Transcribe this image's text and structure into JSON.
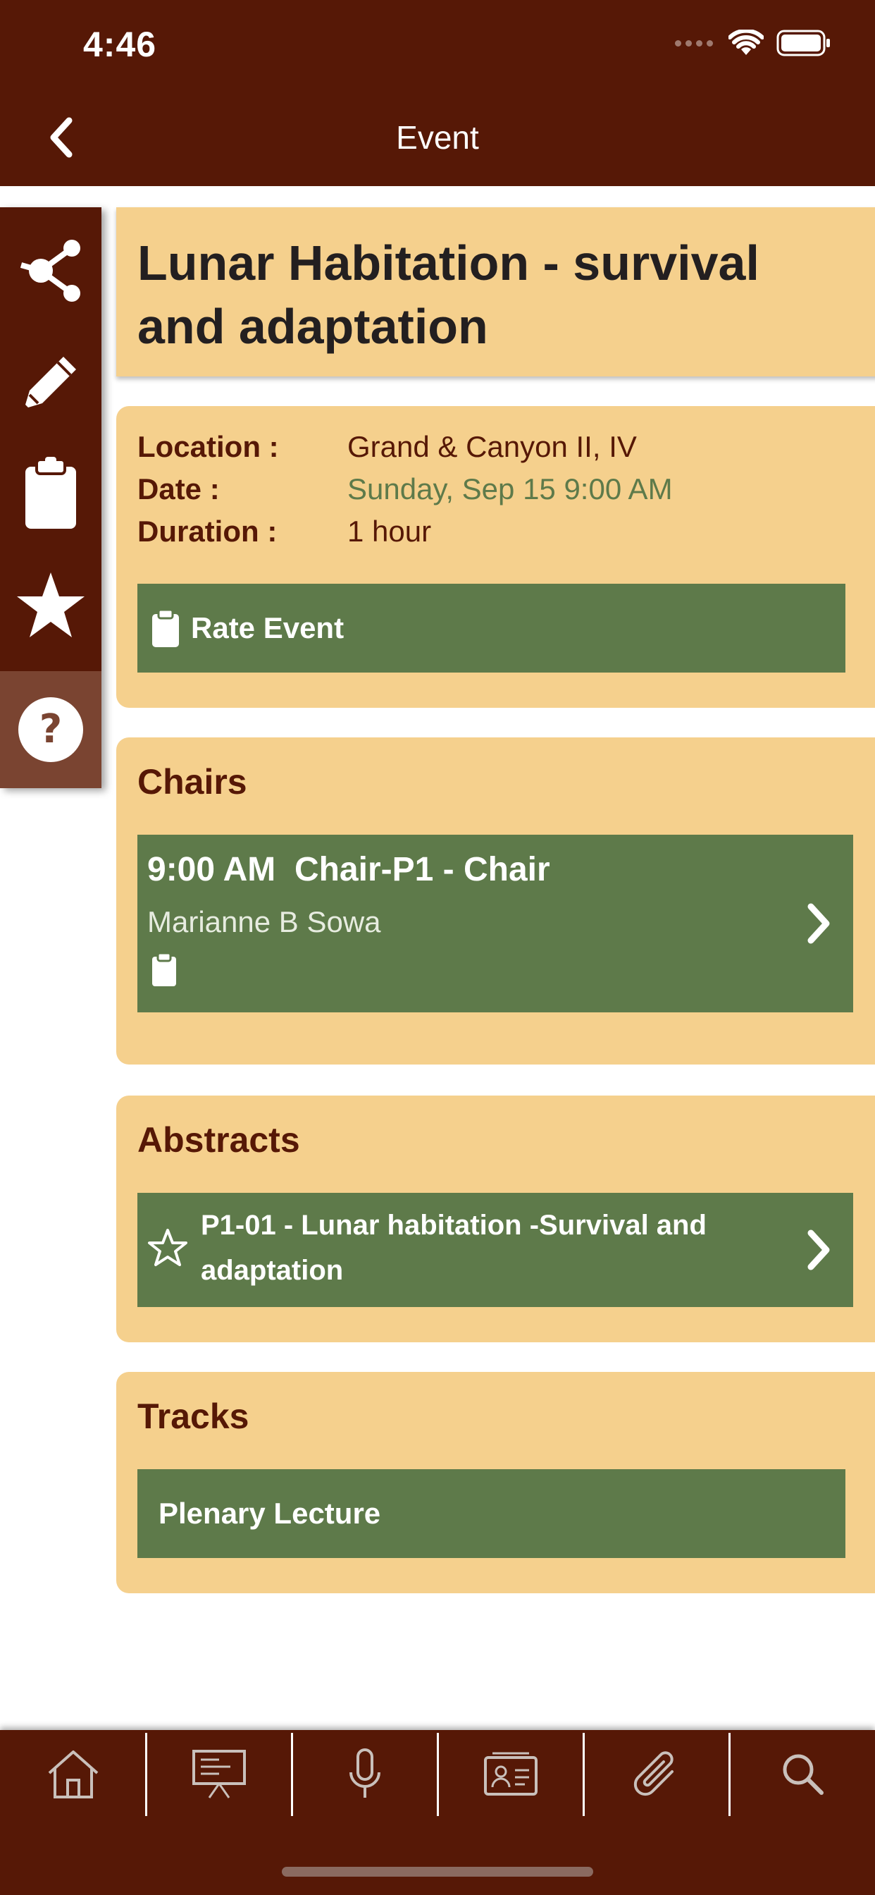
{
  "status_bar": {
    "time": "4:46"
  },
  "header": {
    "title": "Event",
    "back_icon": "chevron-left-icon"
  },
  "side_toolbar": {
    "items": [
      {
        "icon": "share-icon"
      },
      {
        "icon": "pencil-icon"
      },
      {
        "icon": "clipboard-icon"
      },
      {
        "icon": "star-icon"
      },
      {
        "icon": "help-icon"
      }
    ]
  },
  "event": {
    "title": "Lunar Habitation - survival and adaptation",
    "location_label": "Location :",
    "location": "Grand & Canyon II, IV",
    "date_label": "Date :",
    "date": "Sunday, Sep 15 9:00 AM",
    "duration_label": "Duration :",
    "duration": "1 hour",
    "rate_label": "Rate Event"
  },
  "chairs": {
    "title": "Chairs",
    "items": [
      {
        "heading": "9:00 AM  Chair-P1 - Chair",
        "name": "Marianne B Sowa"
      }
    ]
  },
  "abstracts": {
    "title": "Abstracts",
    "items": [
      {
        "text": "P1-01 - Lunar habitation -Survival and adaptation"
      }
    ]
  },
  "tracks": {
    "title": "Tracks",
    "items": [
      {
        "label": "Plenary Lecture"
      }
    ]
  },
  "tabbar": {
    "items": [
      {
        "icon": "home-icon"
      },
      {
        "icon": "presentation-icon"
      },
      {
        "icon": "microphone-icon"
      },
      {
        "icon": "contact-card-icon"
      },
      {
        "icon": "paperclip-icon"
      },
      {
        "icon": "search-icon"
      }
    ]
  },
  "colors": {
    "primary_dark": "#561806",
    "card_background": "#f5d08d",
    "accent_green": "#5e7a4a",
    "help_button": "#7a4431"
  }
}
